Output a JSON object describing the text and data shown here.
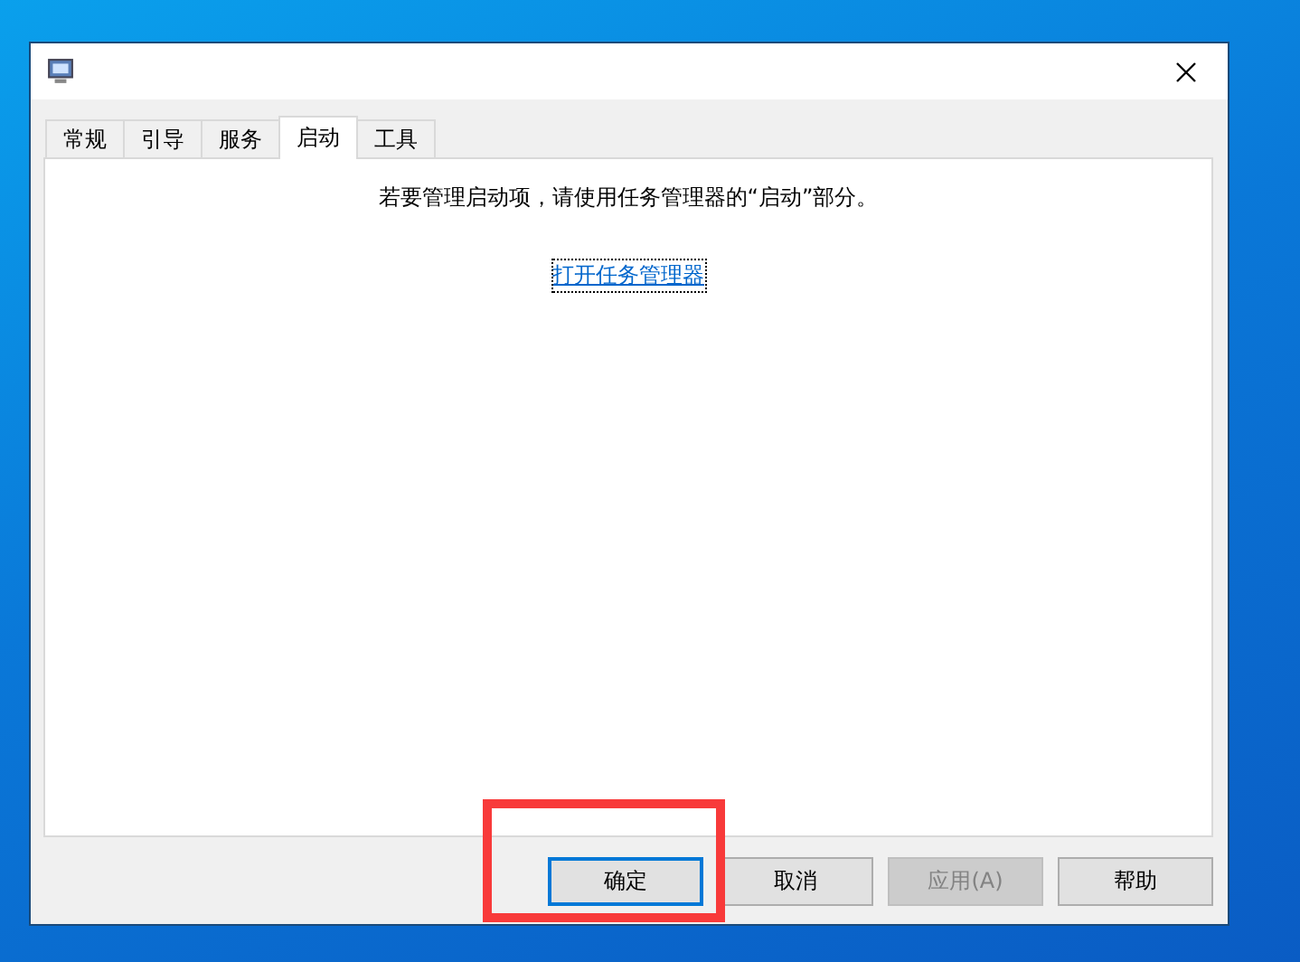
{
  "tabs": [
    {
      "label": "常规",
      "selected": false
    },
    {
      "label": "引导",
      "selected": false
    },
    {
      "label": "服务",
      "selected": false
    },
    {
      "label": "启动",
      "selected": true
    },
    {
      "label": "工具",
      "selected": false
    }
  ],
  "startup_panel": {
    "message": "若要管理启动项，请使用任务管理器的“启动”部分。",
    "link": "打开任务管理器"
  },
  "buttons": [
    {
      "label": "确定",
      "default": true,
      "disabled": false,
      "highlighted": true
    },
    {
      "label": "取消",
      "default": false,
      "disabled": false,
      "highlighted": false
    },
    {
      "label": "应用(A)",
      "default": false,
      "disabled": true,
      "highlighted": false
    },
    {
      "label": "帮助",
      "default": false,
      "disabled": false,
      "highlighted": false
    }
  ]
}
